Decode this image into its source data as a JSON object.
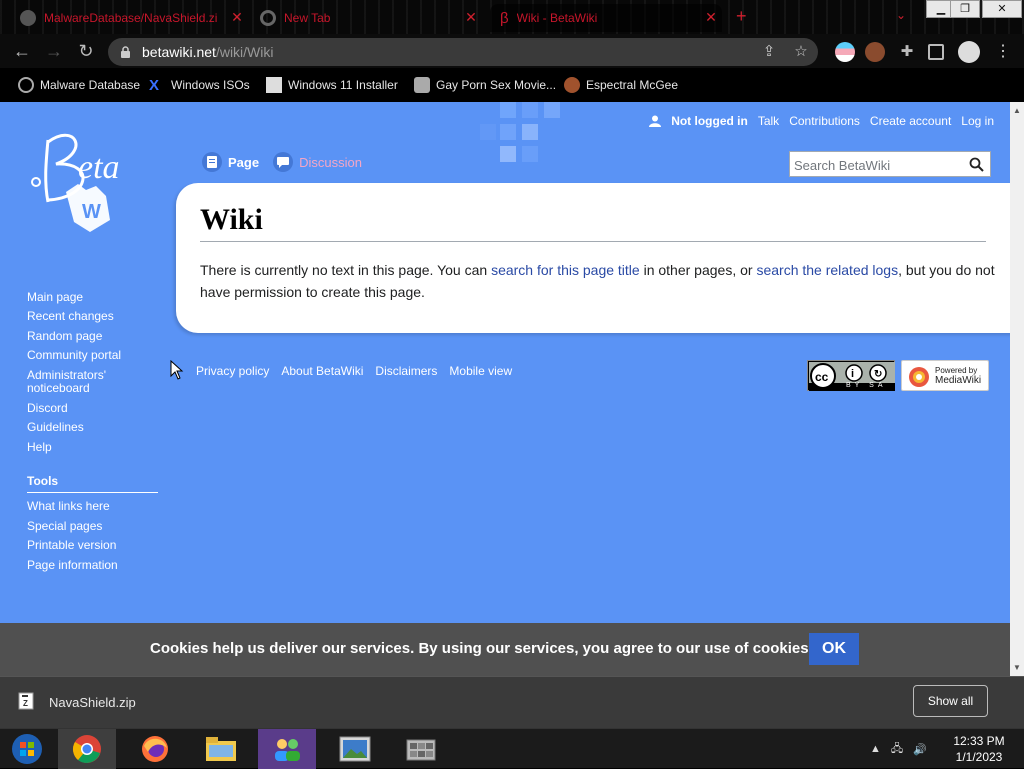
{
  "browser": {
    "tabs": [
      {
        "title": "MalwareDatabase/NavaShield.zi",
        "favicon": "github-icon"
      },
      {
        "title": "New Tab",
        "favicon": "chrome-icon"
      },
      {
        "title": "Wiki - BetaWiki",
        "favicon": "betawiki-icon"
      }
    ],
    "url_domain": "betawiki.net",
    "url_path": "/wiki/Wiki",
    "bookmarks": [
      "Malware Database",
      "Windows ISOs",
      "Windows 11 Installer",
      "Gay Porn Sex Movie...",
      "Espectral McGee"
    ]
  },
  "wiki": {
    "personal": {
      "not_logged_in": "Not logged in",
      "talk": "Talk",
      "contributions": "Contributions",
      "create_account": "Create account",
      "log_in": "Log in"
    },
    "tabs": {
      "page": "Page",
      "discussion": "Discussion"
    },
    "search_placeholder": "Search BetaWiki",
    "sidebar": {
      "nav": [
        "Main page",
        "Recent changes",
        "Random page",
        "Community portal",
        "Administrators' noticeboard",
        "Discord",
        "Guidelines",
        "Help"
      ],
      "tools_heading": "Tools",
      "tools": [
        "What links here",
        "Special pages",
        "Printable version",
        "Page information"
      ]
    },
    "title": "Wiki",
    "body": {
      "part1": "There is currently no text in this page. You can ",
      "link1": "search for this page title",
      "part2": " in other pages, or ",
      "link2": "search the related logs",
      "part3": ", but you do not have permission to create this page."
    },
    "footer": [
      "Privacy policy",
      "About BetaWiki",
      "Disclaimers",
      "Mobile view"
    ],
    "cc_badge": "BY SA",
    "mw_badge_top": "Powered by",
    "mw_badge_bottom": "MediaWiki",
    "cookie_text": "Cookies help us deliver our services. By using our services, you agree to our use of cookies.",
    "cookie_ok": "OK"
  },
  "downloads": {
    "filename": "NavaShield.zip",
    "show_all": "Show all"
  },
  "taskbar": {
    "time": "12:33 PM",
    "date": "1/1/2023"
  },
  "colors": {
    "page_bg": "#5a93f5",
    "link": "#2a4aa5",
    "tab_text": "#c7162b",
    "cookie_button": "#3366cc"
  }
}
